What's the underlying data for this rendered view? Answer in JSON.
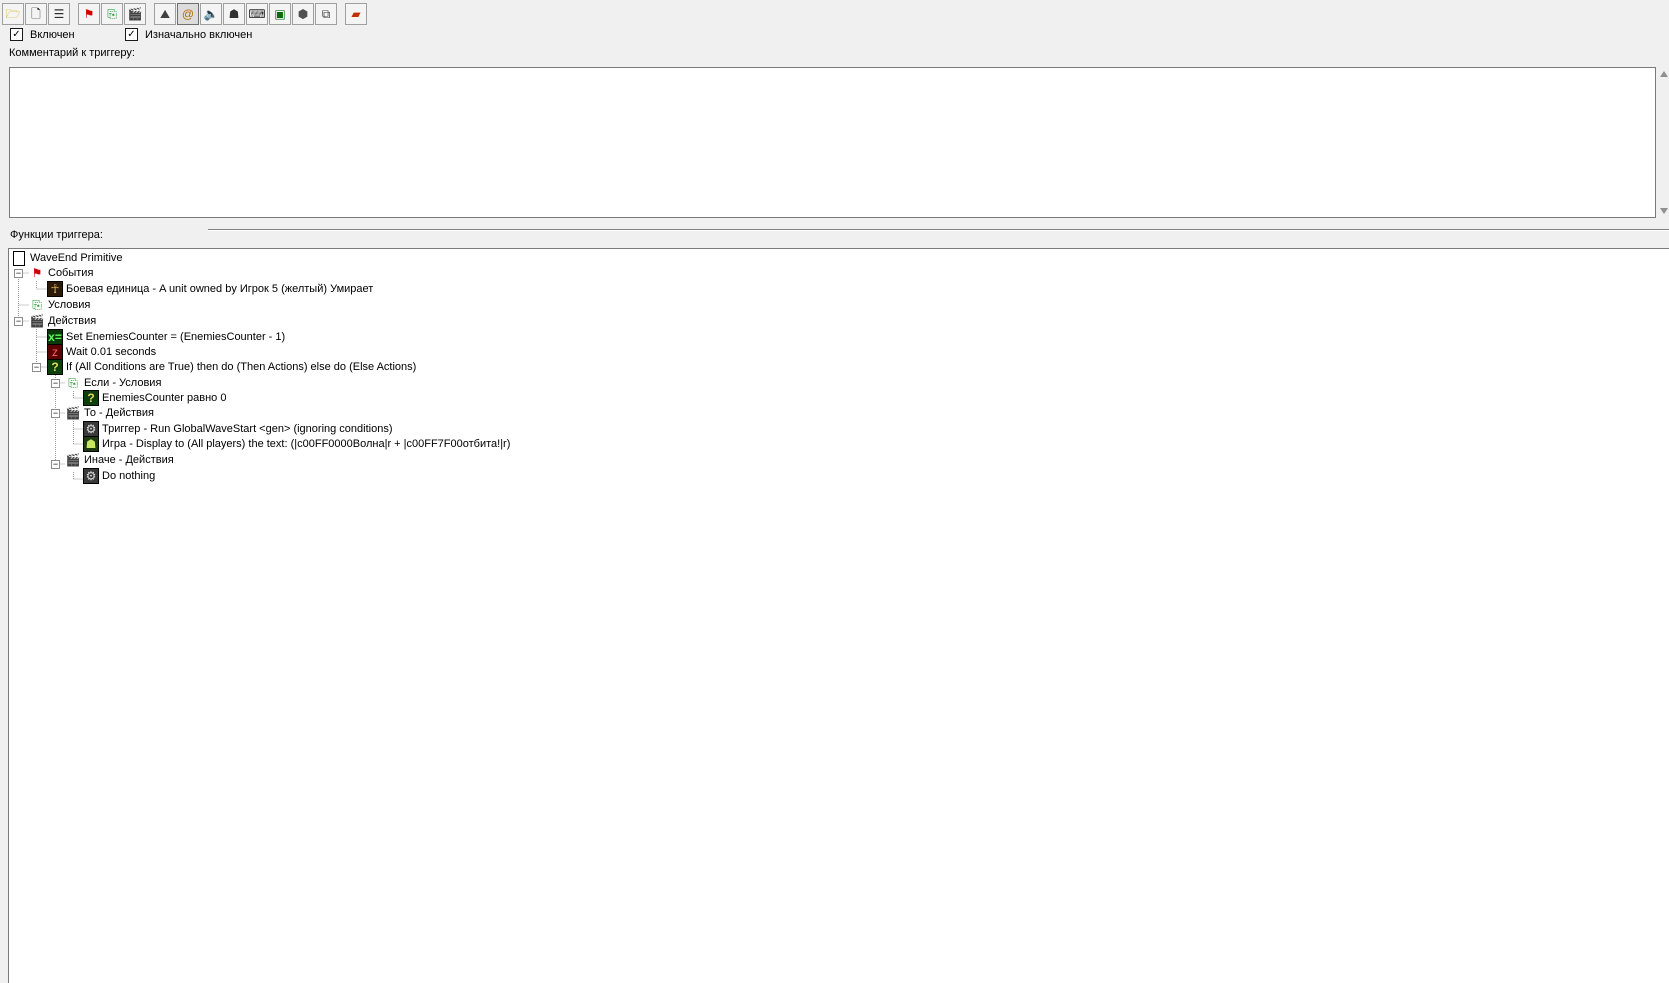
{
  "toolbar": {
    "buttons": [
      {
        "name": "open-folder-icon",
        "glyph": "🗁",
        "color": "#d8a800",
        "pressed": false
      },
      {
        "name": "new-document-icon",
        "glyph": "🗋",
        "color": "#000000",
        "pressed": false
      },
      {
        "name": "list-panel-icon",
        "glyph": "☰",
        "color": "#303030",
        "pressed": false
      },
      {
        "name": "red-flag-icon",
        "glyph": "⚑",
        "color": "#d00000",
        "pressed": false
      },
      {
        "name": "condition-icon",
        "glyph": "⎘",
        "color": "#1c8f2a",
        "pressed": false
      },
      {
        "name": "action-clapper-icon",
        "glyph": "🎬",
        "color": "#222222",
        "pressed": false
      },
      {
        "name": "terrain-icon",
        "glyph": "⛰",
        "color": "#404040",
        "pressed": false
      },
      {
        "name": "at-sign-icon",
        "glyph": "@",
        "color": "#b07000",
        "pressed": true
      },
      {
        "name": "speaker-icon",
        "glyph": "🔈",
        "color": "#a08000",
        "pressed": false
      },
      {
        "name": "unit-head-icon",
        "glyph": "☗",
        "color": "#303030",
        "pressed": false
      },
      {
        "name": "keyboard-icon",
        "glyph": "⌨",
        "color": "#303030",
        "pressed": false
      },
      {
        "name": "variable-icon",
        "glyph": "▣",
        "color": "#0a6a0a",
        "pressed": false
      },
      {
        "name": "import-box-icon",
        "glyph": "⬢",
        "color": "#505050",
        "pressed": false
      },
      {
        "name": "copy-icon",
        "glyph": "⧉",
        "color": "#404040",
        "pressed": false
      },
      {
        "name": "test-map-icon",
        "glyph": "▰",
        "color": "#c03000",
        "pressed": false
      }
    ]
  },
  "checkboxes": {
    "enabled": {
      "label": "Включен",
      "checked": "✓"
    },
    "initially_on": {
      "label": "Изначально включен",
      "checked": "✓"
    }
  },
  "comment_label": "Комментарий к триггеру:",
  "functions_label": "Функции триггера:",
  "tree": {
    "root": "WaveEnd Primitive",
    "events": {
      "label": "События",
      "items": [
        "Боевая единица - A unit owned by Игрок 5 (желтый) Умирает"
      ]
    },
    "conditions": {
      "label": "Условия"
    },
    "actions": {
      "label": "Действия",
      "set": "Set EnemiesCounter = (EnemiesCounter - 1)",
      "wait": "Wait 0.01 seconds",
      "if": "If (All Conditions are True) then do (Then Actions) else do (Else Actions)",
      "if_conditions": "Если - Условия",
      "if_condition_item": "EnemiesCounter равно 0",
      "then_actions": "То - Действия",
      "then_item_1": "Триггер - Run GlobalWaveStart <gen> (ignoring conditions)",
      "then_item_2": "Игра - Display to (All players) the text: (|c00FF0000Волна|r  + |c00FF7F00отбита!|r)",
      "else_actions": "Иначе - Действия",
      "else_item": "Do nothing"
    }
  }
}
